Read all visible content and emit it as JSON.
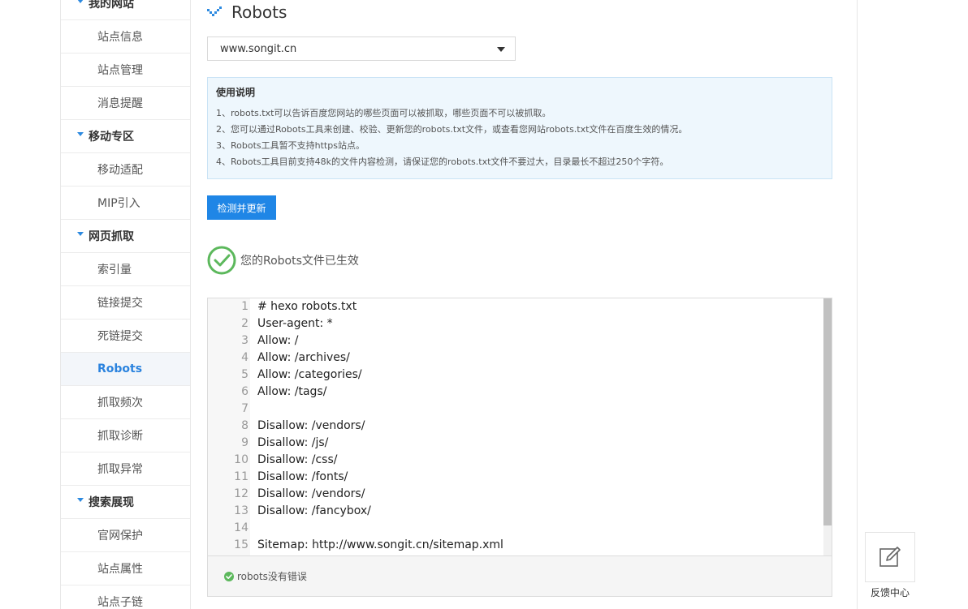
{
  "sidebar": {
    "items": [
      {
        "type": "group",
        "label": "我的网站"
      },
      {
        "type": "link",
        "label": "站点信息"
      },
      {
        "type": "link",
        "label": "站点管理"
      },
      {
        "type": "link",
        "label": "消息提醒"
      },
      {
        "type": "group",
        "label": "移动专区"
      },
      {
        "type": "link",
        "label": "移动适配"
      },
      {
        "type": "link",
        "label": "MIP引入"
      },
      {
        "type": "group",
        "label": "网页抓取"
      },
      {
        "type": "link",
        "label": "索引量"
      },
      {
        "type": "link",
        "label": "链接提交"
      },
      {
        "type": "link",
        "label": "死链提交"
      },
      {
        "type": "link",
        "label": "Robots",
        "active": true
      },
      {
        "type": "link",
        "label": "抓取频次"
      },
      {
        "type": "link",
        "label": "抓取诊断"
      },
      {
        "type": "link",
        "label": "抓取异常"
      },
      {
        "type": "group",
        "label": "搜索展现"
      },
      {
        "type": "link",
        "label": "官网保护"
      },
      {
        "type": "link",
        "label": "站点属性"
      },
      {
        "type": "link",
        "label": "站点子链"
      }
    ]
  },
  "page": {
    "title": "Robots"
  },
  "site_select": {
    "value": "www.songit.cn"
  },
  "instructions": {
    "title": "使用说明",
    "lines": [
      "1、robots.txt可以告诉百度您网站的哪些页面可以被抓取，哪些页面不可以被抓取。",
      "2、您可以通过Robots工具来创建、校验、更新您的robots.txt文件，或查看您网站robots.txt文件在百度生效的情况。",
      "3、Robots工具暂不支持https站点。",
      "4、Robots工具目前支持48k的文件内容检测，请保证您的robots.txt文件不要过大，目录最长不超过250个字符。"
    ]
  },
  "check_button": {
    "label": "检测并更新"
  },
  "status": {
    "text": "您的Robots文件已生效"
  },
  "editor": {
    "lines": [
      {
        "n": "1",
        "text": "# hexo robots.txt"
      },
      {
        "n": "2",
        "text": "User-agent: *"
      },
      {
        "n": "3",
        "text": "Allow: /"
      },
      {
        "n": "4",
        "text": "Allow: /archives/"
      },
      {
        "n": "5",
        "text": "Allow: /categories/"
      },
      {
        "n": "6",
        "text": "Allow: /tags/"
      },
      {
        "n": "7",
        "text": ""
      },
      {
        "n": "8",
        "text": "Disallow: /vendors/"
      },
      {
        "n": "9",
        "text": "Disallow: /js/"
      },
      {
        "n": "10",
        "text": "Disallow: /css/"
      },
      {
        "n": "11",
        "text": "Disallow: /fonts/"
      },
      {
        "n": "12",
        "text": "Disallow: /vendors/"
      },
      {
        "n": "13",
        "text": "Disallow: /fancybox/"
      },
      {
        "n": "14",
        "text": ""
      },
      {
        "n": "15",
        "text": "Sitemap: http://www.songit.cn/sitemap.xml"
      }
    ],
    "result": "robots没有错误"
  },
  "feedback": {
    "label": "反馈中心"
  },
  "colors": {
    "accent": "#1f86e6",
    "success": "#5cb85c",
    "info_bg": "#eef7fd"
  }
}
